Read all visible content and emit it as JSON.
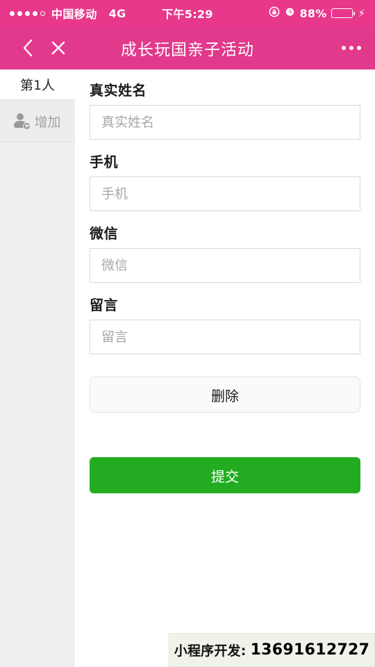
{
  "status_bar": {
    "signal_dots_filled": 4,
    "signal_dots_total": 5,
    "carrier": "中国移动",
    "network": "4G",
    "time": "下午5:29",
    "battery_percent": "88%",
    "battery_level": 88,
    "rotation_lock_icon": "rotation-lock-icon",
    "alarm_icon": "alarm-clock-icon",
    "charging_icon": "lightning-bolt-icon",
    "background_color": "#e8388c"
  },
  "navbar": {
    "back_icon": "back-chevron-icon",
    "close_icon": "close-x-icon",
    "title": "成长玩国亲子活动",
    "more_icon": "more-dots-icon",
    "background_color": "#e1398c"
  },
  "sidebar": {
    "person_tab": {
      "label": "第1人",
      "active": true
    },
    "add_item": {
      "label": "增加",
      "icon": "add-person-icon"
    },
    "background_color": "#efefef"
  },
  "form": {
    "fields": [
      {
        "label": "真实姓名",
        "placeholder": "真实姓名",
        "value": "",
        "name": "real-name"
      },
      {
        "label": "手机",
        "placeholder": "手机",
        "value": "",
        "name": "phone"
      },
      {
        "label": "微信",
        "placeholder": "微信",
        "value": "",
        "name": "wechat"
      },
      {
        "label": "留言",
        "placeholder": "留言",
        "value": "",
        "name": "message"
      }
    ],
    "delete_label": "删除",
    "submit_label": "提交",
    "submit_color": "#23ac22"
  },
  "promo": {
    "prefix": "小程序开发:",
    "phone": "13691612727",
    "background_color": "#eff3e9"
  }
}
